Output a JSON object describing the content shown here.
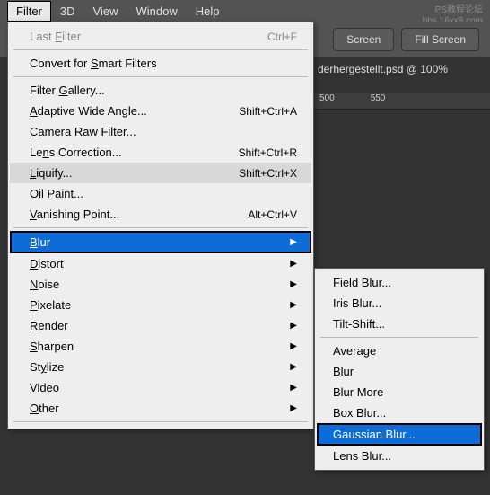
{
  "watermark": {
    "line1": "PS教程论坛",
    "line2": "bbs.16xx8.com"
  },
  "menubar": {
    "items": [
      {
        "label": "Filter",
        "active": true
      },
      {
        "label": "3D"
      },
      {
        "label": "View"
      },
      {
        "label": "Window"
      },
      {
        "label": "Help"
      }
    ]
  },
  "toolbar": {
    "screen_btn": "Screen",
    "fill_screen_btn": "Fill Screen"
  },
  "document": {
    "title_fragment": "derhergestellt.psd @ 100%",
    "ruler_ticks": [
      "500",
      "550"
    ]
  },
  "filter_menu": {
    "last_filter": {
      "label": "Last Filter",
      "shortcut": "Ctrl+F",
      "disabled": true
    },
    "convert_smart": {
      "label": "Convert for Smart Filters"
    },
    "filter_gallery": {
      "label": "Filter Gallery..."
    },
    "adaptive_wide": {
      "label": "Adaptive Wide Angle...",
      "shortcut": "Shift+Ctrl+A"
    },
    "camera_raw": {
      "label": "Camera Raw Filter..."
    },
    "lens_correction": {
      "label": "Lens Correction...",
      "shortcut": "Shift+Ctrl+R"
    },
    "liquify": {
      "label": "Liquify...",
      "shortcut": "Shift+Ctrl+X"
    },
    "oil_paint": {
      "label": "Oil Paint..."
    },
    "vanishing_point": {
      "label": "Vanishing Point...",
      "shortcut": "Alt+Ctrl+V"
    },
    "blur": {
      "label": "Blur"
    },
    "distort": {
      "label": "Distort"
    },
    "noise": {
      "label": "Noise"
    },
    "pixelate": {
      "label": "Pixelate"
    },
    "render": {
      "label": "Render"
    },
    "sharpen": {
      "label": "Sharpen"
    },
    "stylize": {
      "label": "Stylize"
    },
    "video": {
      "label": "Video"
    },
    "other": {
      "label": "Other"
    }
  },
  "blur_submenu": {
    "field_blur": "Field Blur...",
    "iris_blur": "Iris Blur...",
    "tilt_shift": "Tilt-Shift...",
    "average": "Average",
    "blur": "Blur",
    "blur_more": "Blur More",
    "box_blur": "Box Blur...",
    "gaussian_blur": "Gaussian Blur...",
    "lens_blur": "Lens Blur..."
  }
}
